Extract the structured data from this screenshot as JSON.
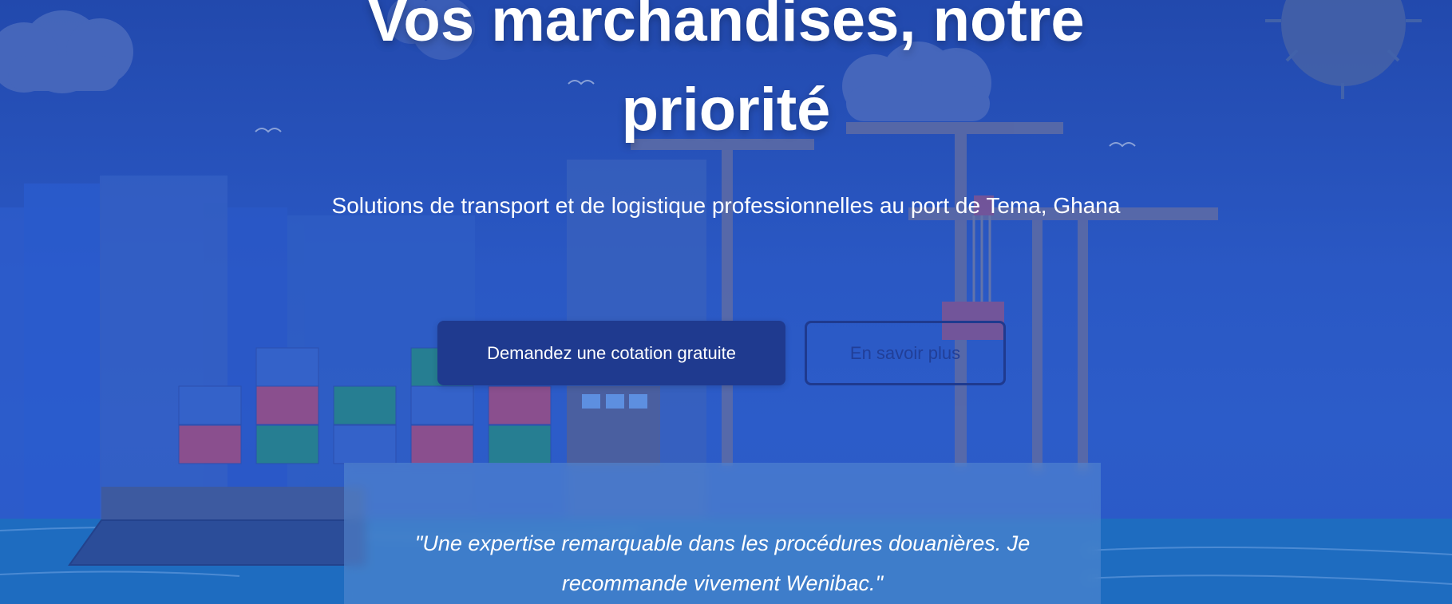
{
  "hero": {
    "title": "Vos marchandises, notre priorité",
    "subtitle": "Solutions de transport et de logistique professionnelles au port de Tema, Ghana",
    "primary_cta": "Demandez une cotation gratuite",
    "secondary_cta": "En savoir plus"
  },
  "testimonial": {
    "quote": "\"Une expertise remarquable dans les procédures douanières. Je recommande vivement Wenibac.\""
  },
  "colors": {
    "background": "#2a58c4",
    "primary_button": "#1f3a8f",
    "sea": "#1e6cc0",
    "text": "#ffffff"
  },
  "icons": [
    "cloud-icon",
    "sun-icon",
    "bird-icon",
    "crane-icon",
    "container-icon",
    "ship-icon"
  ]
}
